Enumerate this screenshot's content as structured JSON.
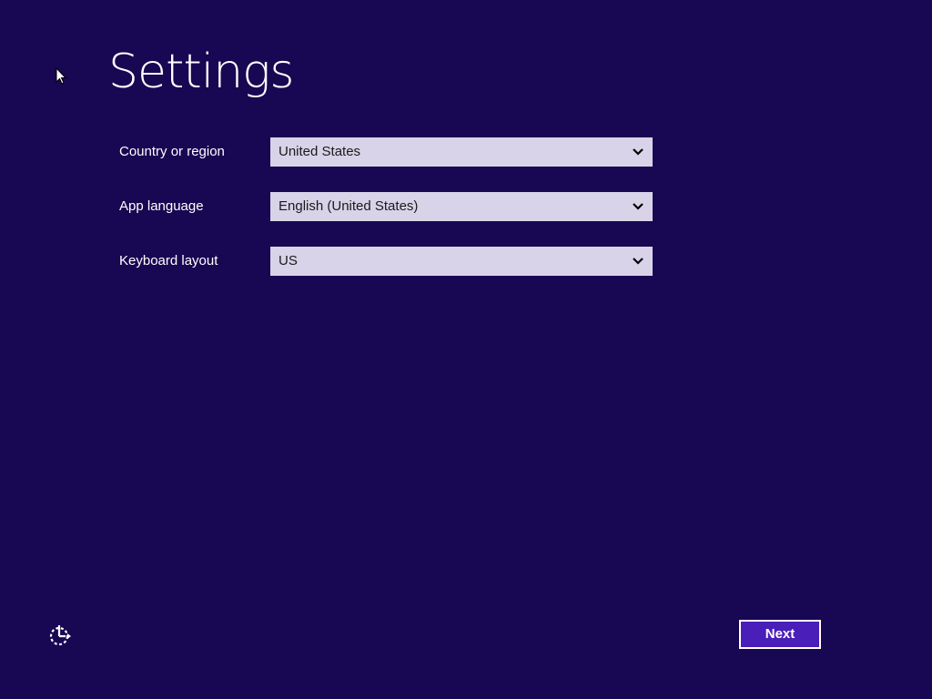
{
  "page": {
    "title": "Settings",
    "background_color": "#180752"
  },
  "fields": [
    {
      "label": "Country or region",
      "value": "United States",
      "icon": "chevron-down-icon"
    },
    {
      "label": "App language",
      "value": "English (United States)",
      "icon": "chevron-down-icon"
    },
    {
      "label": "Keyboard layout",
      "value": "US",
      "icon": "chevron-down-icon"
    }
  ],
  "footer": {
    "ease_of_access_icon": "ease-of-access-icon",
    "next_label": "Next",
    "accent_color": "#4a1eb8"
  }
}
